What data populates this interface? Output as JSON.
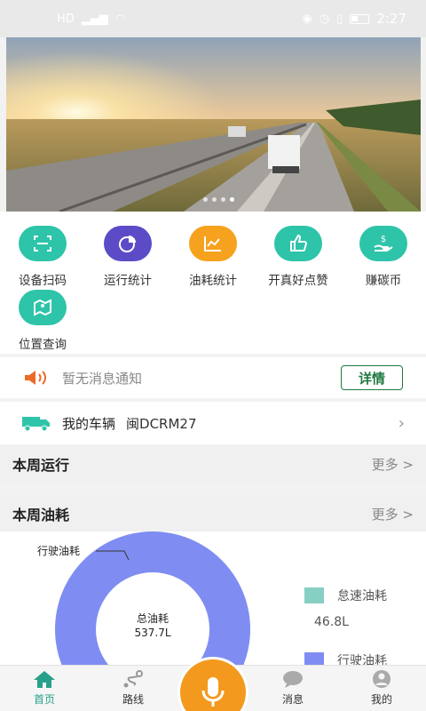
{
  "status_bar": {
    "time": "2:27"
  },
  "banner": {
    "image_description": "highway at sunset with trucks",
    "dot_count": 4,
    "active_dot": 3
  },
  "functions": [
    {
      "label": "设备扫码",
      "icon": "scan-icon",
      "color": "#2ec4a9"
    },
    {
      "label": "运行统计",
      "icon": "pie-chart-icon",
      "color": "#5c4bc7"
    },
    {
      "label": "油耗统计",
      "icon": "line-chart-icon",
      "color": "#f6a21e"
    },
    {
      "label": "开真好点赞",
      "icon": "thumbs-up-icon",
      "color": "#2ec4a9"
    },
    {
      "label": "赚碳币",
      "icon": "coin-hand-icon",
      "color": "#2ec4a9"
    },
    {
      "label": "位置查询",
      "icon": "map-pin-icon",
      "color": "#2ec4a9"
    }
  ],
  "notice": {
    "text": "暂无消息通知",
    "button": "详情"
  },
  "vehicle": {
    "label": "我的车辆",
    "plate": "闽DCRM27"
  },
  "sections": {
    "weekly_run": {
      "title": "本周运行",
      "more": "更多 >"
    },
    "weekly_fuel": {
      "title": "本周油耗",
      "more": "更多 >"
    }
  },
  "chart_data": {
    "type": "pie",
    "center_label": "总油耗",
    "center_value": "537.7L",
    "callout": "行驶油耗",
    "legend": [
      {
        "name": "怠速油耗",
        "value": "46.8L",
        "color": "#86cfc4"
      },
      {
        "name": "行驶油耗",
        "value": "",
        "color": "#7f8df2"
      }
    ]
  },
  "tabs": [
    {
      "label": "首页",
      "icon": "home-icon",
      "active": true
    },
    {
      "label": "路线",
      "icon": "route-icon",
      "active": false
    },
    {
      "label": "消息",
      "icon": "message-icon",
      "active": false
    },
    {
      "label": "我的",
      "icon": "user-icon",
      "active": false
    }
  ]
}
